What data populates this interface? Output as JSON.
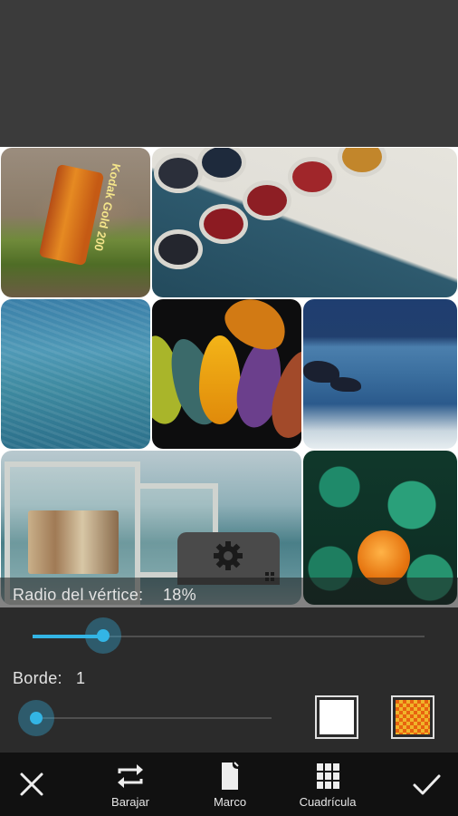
{
  "collage": {
    "film_text_line1": "Kodak",
    "film_text_line2": "Gold",
    "film_text_line3": "200"
  },
  "settings": {
    "radius_label": "Radio del vértice:",
    "radius_value": "18%",
    "radius_level": 0.18,
    "border_label": "Borde:",
    "border_value": "1",
    "border_level": 0.0
  },
  "swatches": {
    "accent_color": "#33b5e5",
    "solid_color": "#ffffff",
    "pattern_colors": [
      "#e8630f",
      "#f0b42a"
    ]
  },
  "toolbar": {
    "cancel_icon": "close-icon",
    "shuffle_label": "Barajar",
    "frame_label": "Marco",
    "grid_label": "Cuadrícula",
    "confirm_icon": "check-icon"
  }
}
